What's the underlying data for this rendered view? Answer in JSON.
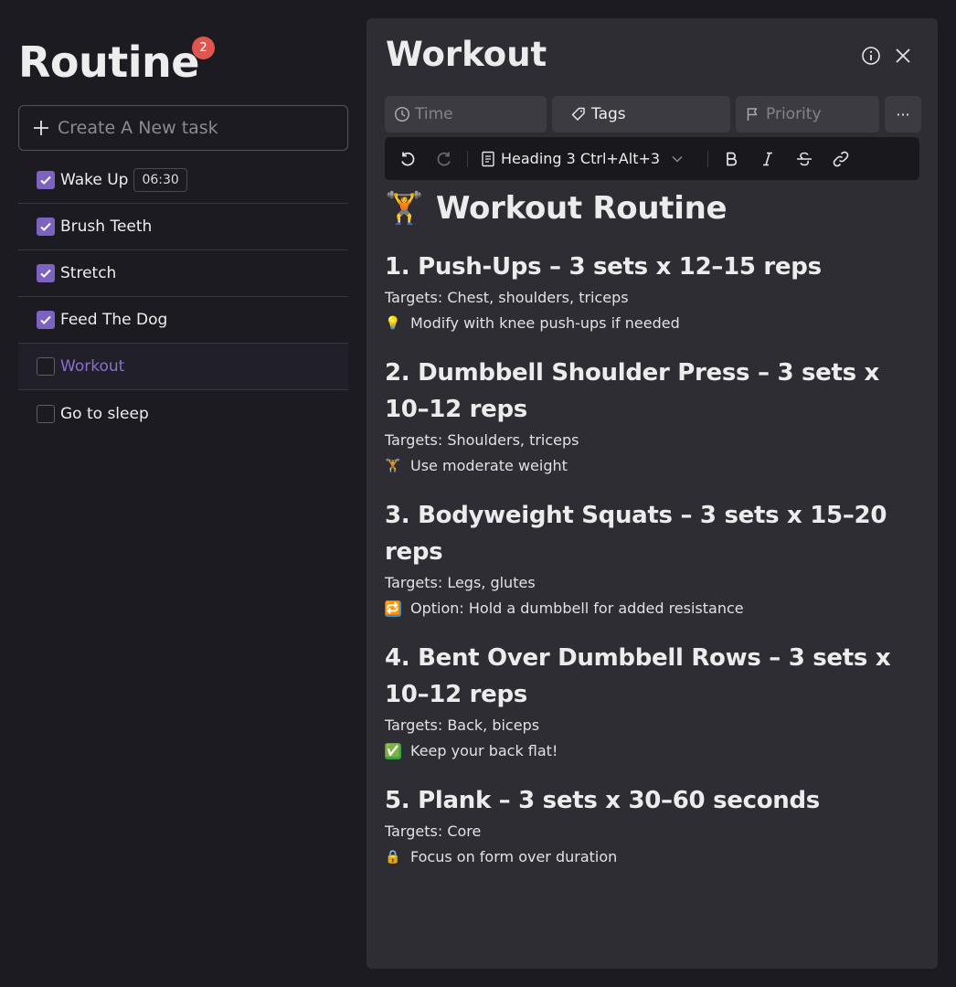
{
  "app": {
    "title": "Routine",
    "badge_count": "2",
    "new_task_placeholder": "Create A New task"
  },
  "tasks": [
    {
      "label": "Wake Up",
      "checked": true,
      "time": "06:30"
    },
    {
      "label": "Brush Teeth",
      "checked": true
    },
    {
      "label": "Stretch",
      "checked": true
    },
    {
      "label": "Feed The Dog",
      "checked": true
    },
    {
      "label": "Workout",
      "checked": false,
      "active": true
    },
    {
      "label": "Go to sleep",
      "checked": false
    }
  ],
  "panel": {
    "title": "Workout",
    "properties": {
      "time": "Time",
      "tags": "Tags",
      "priority": "Priority",
      "more": "···"
    },
    "toolbar": {
      "heading_select": "Heading 3 Ctrl+Alt+3"
    },
    "document": {
      "title_emoji": "🏋️",
      "title": "Workout Routine",
      "exercises": [
        {
          "title": "1. Push-Ups – 3 sets x 12–15 reps",
          "targets": "Targets: Chest, shoulders, triceps",
          "tip_emoji": "💡",
          "tip": "Modify with knee push-ups if needed"
        },
        {
          "title": "2. Dumbbell Shoulder Press – 3 sets x 10–12 reps",
          "targets": "Targets: Shoulders, triceps",
          "tip_emoji": "🏋️",
          "tip": "Use moderate weight"
        },
        {
          "title": "3. Bodyweight Squats – 3 sets x 15–20 reps",
          "targets": "Targets: Legs, glutes",
          "tip_emoji": "🔁",
          "tip": "Option: Hold a dumbbell for added resistance"
        },
        {
          "title": "4. Bent Over Dumbbell Rows – 3 sets x 10–12 reps",
          "targets": "Targets: Back, biceps",
          "tip_emoji": "✅",
          "tip": "Keep your back flat!"
        },
        {
          "title": "5. Plank – 3 sets x 30–60 seconds",
          "targets": "Targets: Core",
          "tip_emoji": "🔒",
          "tip": "Focus on form over duration"
        }
      ]
    }
  },
  "colors": {
    "background": "#1c1b21",
    "panel": "#2e2d33",
    "accent": "#7b63bf",
    "active_text": "#8a6fd0",
    "badge": "#e0554f"
  }
}
